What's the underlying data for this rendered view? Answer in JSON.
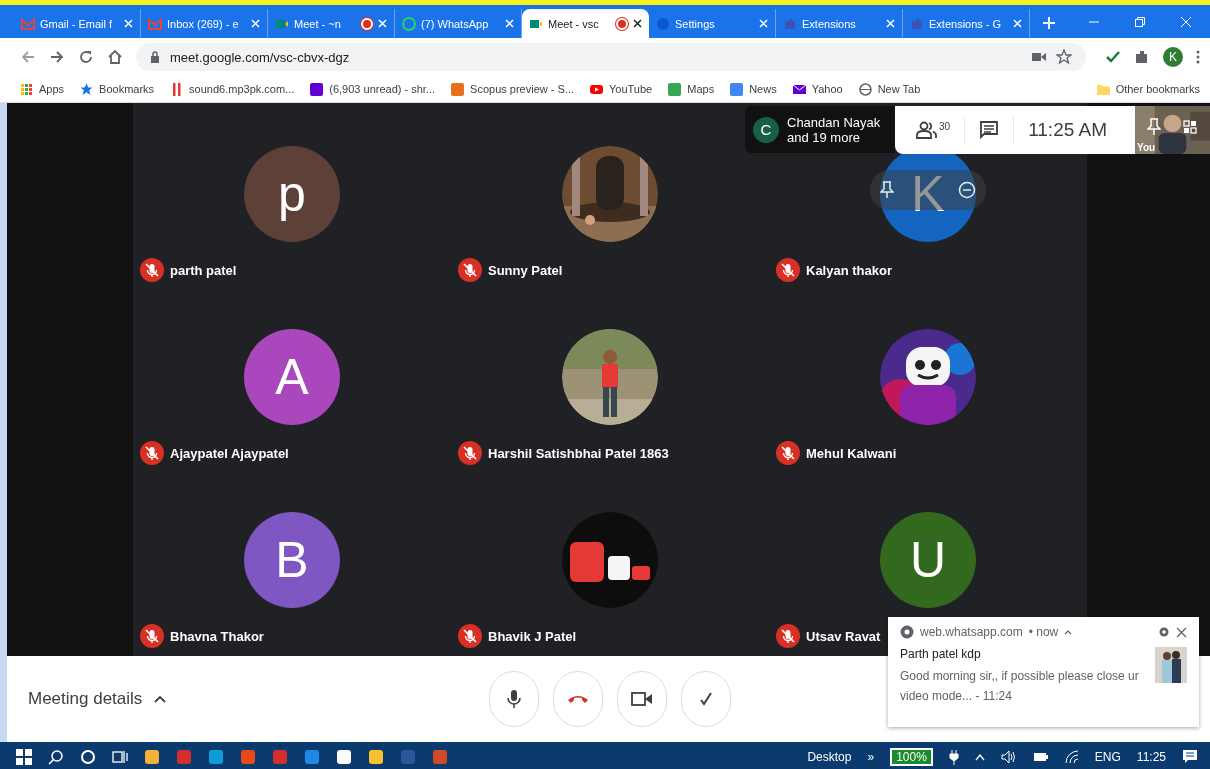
{
  "browser": {
    "tabs": [
      {
        "title": "Gmail - Email f",
        "selected": false,
        "recording": false
      },
      {
        "title": "Inbox (269) - e",
        "selected": false,
        "recording": false
      },
      {
        "title": "Meet - ~n",
        "selected": false,
        "recording": true
      },
      {
        "title": "(7) WhatsApp",
        "selected": false,
        "recording": false
      },
      {
        "title": "Meet - vsc",
        "selected": true,
        "recording": true
      },
      {
        "title": "Settings",
        "selected": false,
        "recording": false
      },
      {
        "title": "Extensions",
        "selected": false,
        "recording": false
      },
      {
        "title": "Extensions - G",
        "selected": false,
        "recording": false
      }
    ],
    "address": "meet.google.com/vsc-cbvx-dgz",
    "profile": "K",
    "bookmarks": [
      {
        "label": "Apps"
      },
      {
        "label": "Bookmarks"
      },
      {
        "label": "sound6.mp3pk.com..."
      },
      {
        "label": "(6,903 unread) - shr..."
      },
      {
        "label": "Scopus preview - S..."
      },
      {
        "label": "YouTube"
      },
      {
        "label": "Maps"
      },
      {
        "label": "News"
      },
      {
        "label": "Yahoo"
      },
      {
        "label": "New Tab"
      }
    ],
    "other_bookmarks": "Other bookmarks"
  },
  "meet": {
    "presenter": {
      "initial": "C",
      "name": "Chandan Nayak",
      "more": "and 19 more"
    },
    "participant_count": "30",
    "time": "11:25 AM",
    "self_label": "You",
    "participants": [
      {
        "name": "parth patel",
        "muted": true,
        "hovered": false,
        "avatar": {
          "kind": "letter",
          "letter": "p",
          "color": "#5d4037"
        }
      },
      {
        "name": "Sunny Patel",
        "muted": true,
        "hovered": false
      },
      {
        "name": "Kalyan thakor",
        "muted": true,
        "hovered": true,
        "avatar": {
          "kind": "letter",
          "letter": "K",
          "color": "#1565c0"
        }
      },
      {
        "name": "Ajaypatel Ajaypatel",
        "muted": true,
        "hovered": false,
        "avatar": {
          "kind": "letter",
          "letter": "A",
          "color": "#ab47bc"
        }
      },
      {
        "name": "Harshil Satishbhai Patel 1863",
        "muted": true,
        "hovered": false
      },
      {
        "name": "Mehul Kalwani",
        "muted": true,
        "hovered": false
      },
      {
        "name": "Bhavna Thakor",
        "muted": true,
        "hovered": false,
        "avatar": {
          "kind": "letter",
          "letter": "B",
          "color": "#7e57c2"
        }
      },
      {
        "name": "Bhavik J Patel",
        "muted": true,
        "hovered": false
      },
      {
        "name": "Utsav Ravat",
        "muted": true,
        "hovered": false,
        "avatar": {
          "kind": "letter",
          "letter": "U",
          "color": "#33691e"
        }
      }
    ],
    "meeting_details": "Meeting details"
  },
  "notification": {
    "source": "web.whatsapp.com",
    "age": "• now",
    "title": "Parth patel kdp",
    "body": "Good morning sir,, if possible  please close ur video mode... - 11:24"
  },
  "taskbar": {
    "desktop": "Desktop",
    "more": "»",
    "battery": "100%",
    "language": "ENG",
    "time": "11:25"
  }
}
